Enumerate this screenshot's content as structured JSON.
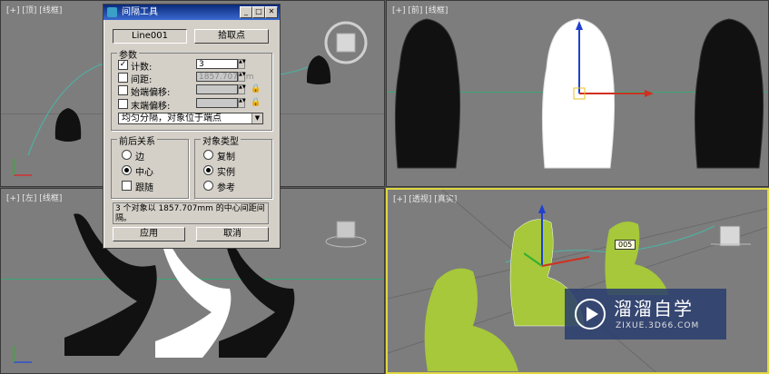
{
  "viewports": {
    "top": {
      "label": "[+] [顶] [线框]"
    },
    "front": {
      "label": "[+] [前] [线框]"
    },
    "left": {
      "label": "[+] [左] [线框]"
    },
    "perspective": {
      "label": "[+] [透视] [真实]"
    }
  },
  "dialog": {
    "title": "间隔工具",
    "path_button": "Line001",
    "pick_points_button": "拾取点",
    "params_group": "参数",
    "count_label": "计数:",
    "count_value": "3",
    "spacing_label": "间距:",
    "spacing_value": "1857.707mm",
    "start_offset_label": "始端偏移:",
    "start_offset_value": "",
    "end_offset_label": "末端偏移:",
    "end_offset_value": "",
    "distribution_value": "均匀分隔，对象位于端点",
    "context_group": "前后关系",
    "context_edges": "边",
    "context_centers": "中心",
    "context_follow": "跟随",
    "object_type_group": "对象类型",
    "type_copy": "复制",
    "type_instance": "实例",
    "type_reference": "参考",
    "status_text": "3 个对象以 1857.707mm 的中心间距间隔。",
    "apply_button": "应用",
    "cancel_button": "取消"
  },
  "tooltip": "005",
  "watermark": {
    "brand": "溜溜自学",
    "url": "ZIXUE.3D66.COM"
  },
  "colors": {
    "viewport_bg": "#7d7d7d",
    "active_border": "#e0d840",
    "chair_green": "#a6c83a"
  }
}
